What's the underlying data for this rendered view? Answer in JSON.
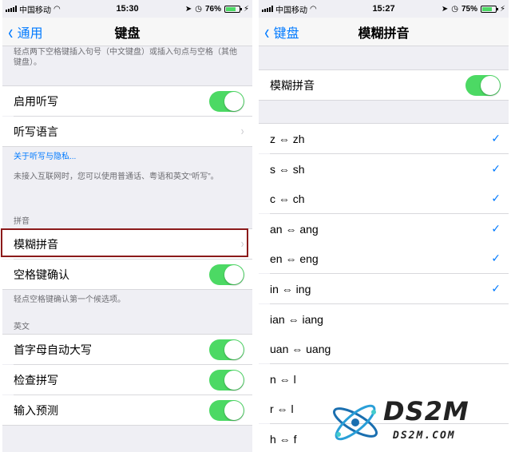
{
  "left": {
    "status": {
      "carrier": "中国移动",
      "time": "15:30",
      "battery": "76%",
      "battery_level": 0.76
    },
    "nav": {
      "back": "通用",
      "title": "键盘"
    },
    "top_note": "轻点两下空格键插入句号（中文键盘）或插入句点与空格（其他键盘）。",
    "dictation": {
      "enable_label": "启用听写",
      "enable_on": true,
      "language_label": "听写语言"
    },
    "privacy_link": "关于听写与隐私...",
    "offline_note": "未接入互联网时，您可以使用普通话、粤语和英文“听写”。",
    "pinyin_header": "拼音",
    "fuzzy_label": "模糊拼音",
    "space_confirm": {
      "label": "空格键确认",
      "on": true
    },
    "space_note": "轻点空格键确认第一个候选项。",
    "english_header": "英文",
    "english": [
      {
        "label": "首字母自动大写",
        "on": true
      },
      {
        "label": "检查拼写",
        "on": true
      },
      {
        "label": "输入预测",
        "on": true
      }
    ]
  },
  "right": {
    "status": {
      "carrier": "中国移动",
      "time": "15:27",
      "battery": "75%",
      "battery_level": 0.75
    },
    "nav": {
      "back": "键盘",
      "title": "模糊拼音"
    },
    "master": {
      "label": "模糊拼音",
      "on": true
    },
    "pairs": [
      {
        "label": "z ⇔ zh",
        "checked": true
      },
      {
        "label": "s ⇔ sh",
        "checked": true
      },
      {
        "label": "c ⇔ ch",
        "checked": true
      },
      {
        "label": "an ⇔ ang",
        "checked": true
      },
      {
        "label": "en ⇔ eng",
        "checked": true
      },
      {
        "label": "in ⇔ ing",
        "checked": true
      },
      {
        "label": "ian ⇔ iang",
        "checked": false
      },
      {
        "label": "uan ⇔ uang",
        "checked": false
      },
      {
        "label": "n ⇔ l",
        "checked": false
      },
      {
        "label": "r ⇔ l",
        "checked": false
      },
      {
        "label": "h ⇔ f",
        "checked": false
      }
    ],
    "check_glyph": "✓"
  },
  "watermark": {
    "title": "DS2M",
    "subtitle": "DS2M.COM"
  },
  "colors": {
    "accent": "#007aff",
    "toggle_on": "#4cd964",
    "highlight": "#8b1a1a"
  }
}
